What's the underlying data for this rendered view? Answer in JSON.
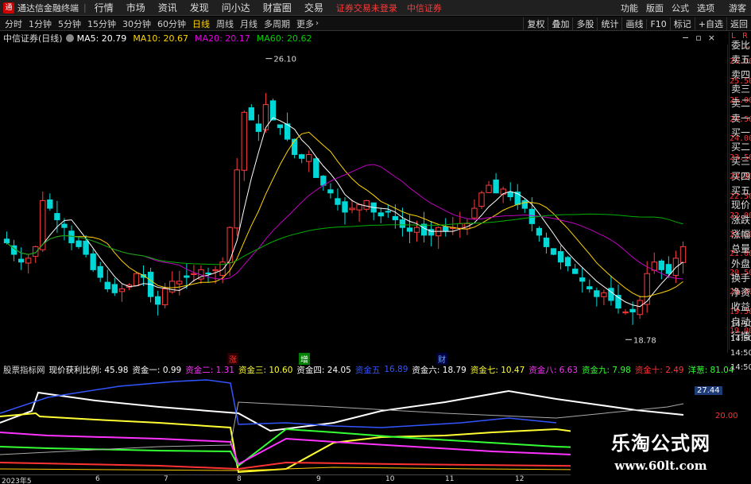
{
  "menubar": {
    "app_title": "通达信金融终端",
    "items": [
      "行情",
      "市场",
      "资讯",
      "发现",
      "问小达",
      "财富圈",
      "交易"
    ],
    "alerts": [
      "证券交易未登录",
      "中信证券"
    ],
    "right_items": [
      "功能",
      "版面",
      "公式",
      "选项",
      "游客"
    ]
  },
  "toolbar": {
    "periods": [
      "分时",
      "1分钟",
      "5分钟",
      "15分钟",
      "30分钟",
      "60分钟",
      "日线",
      "周线",
      "月线",
      "多周期",
      "更多"
    ],
    "active_period": "日线",
    "tools": [
      "复权",
      "叠加",
      "多股",
      "统计",
      "画线",
      "F10",
      "标记",
      "+自选",
      "返回"
    ]
  },
  "info": {
    "name": "中信证券(日线)",
    "ma": [
      {
        "label": "MA5: 20.79",
        "color": "#ffffff"
      },
      {
        "label": "MA10: 20.67",
        "color": "#ffd400"
      },
      {
        "label": "MA20: 20.17",
        "color": "#e000e0"
      },
      {
        "label": "MA60: 20.62",
        "color": "#00d000"
      }
    ]
  },
  "quote_panel": [
    "委比",
    "卖五",
    "卖四",
    "卖三",
    "卖二",
    "卖一",
    "买一",
    "买二",
    "买三",
    "买四",
    "买五",
    "现价",
    "涨跌",
    "涨幅",
    "总量",
    "外盘",
    "换手",
    "净资",
    "收益",
    "自动",
    "行情"
  ],
  "quote_panel_times": [
    "14:50",
    "14:50",
    "14:50",
    "14:50"
  ],
  "quote_panel_header": [
    "L",
    "R",
    "L"
  ],
  "axis": {
    "ticks": [
      "26.00",
      "25.50",
      "25.00",
      "24.50",
      "24.00",
      "23.50",
      "23.00",
      "22.50",
      "22.00",
      "21.50",
      "21.00",
      "20.50",
      "20.00",
      "19.50",
      "19.00"
    ],
    "high_label": "26.10",
    "low_label": "18.78"
  },
  "markers": [
    {
      "text": "涨",
      "color": "#ff3333",
      "bg": "#2a0000"
    },
    {
      "text": "增",
      "color": "#ffffff",
      "bg": "#008000"
    },
    {
      "text": "财",
      "color": "#6fa8ff",
      "bg": "#000040"
    }
  ],
  "indicator": {
    "name": "股票指标网",
    "items": [
      {
        "text": "现价获利比例: 45.98",
        "color": "#ffffff"
      },
      {
        "text": "资金一: 0.99",
        "color": "#ffffff"
      },
      {
        "text": "资金二: 1.31",
        "color": "#ff33ff"
      },
      {
        "text": "资金三: 10.60",
        "color": "#ffff33"
      },
      {
        "text": "资金四: 24.05",
        "color": "#ffffff"
      },
      {
        "text": "资金五",
        "color": "#3355ff"
      },
      {
        "text": "16.89",
        "color": "#3355ff"
      },
      {
        "text": "资金六: 18.79",
        "color": "#ffffff"
      },
      {
        "text": "资金七: 10.47",
        "color": "#ffff33"
      },
      {
        "text": "资金八: 6.63",
        "color": "#ff33ff"
      },
      {
        "text": "资金九: 7.98",
        "color": "#33ff33"
      },
      {
        "text": "资金十: 2.49",
        "color": "#ff3333"
      },
      {
        "text": "洋葱: 81.04",
        "color": "#33ff33"
      }
    ],
    "axis_label": "27.44",
    "axis_label_2": "20.00"
  },
  "dates": [
    "2023年5",
    "6",
    "7",
    "8",
    "9",
    "10",
    "11",
    "12"
  ],
  "watermark": {
    "title": "乐淘公式网",
    "url": "www.60lt.com"
  },
  "chart_data": {
    "type": "candlestick",
    "title": "中信证券(日线)",
    "ylim": [
      18.6,
      26.3
    ],
    "close": [
      21.3,
      21.0,
      20.8,
      20.9,
      21.2,
      22.4,
      22.2,
      21.9,
      21.7,
      21.3,
      21.2,
      21.0,
      20.6,
      20.4,
      20.1,
      20.0,
      20.1,
      20.2,
      20.5,
      20.4,
      19.9,
      19.7,
      20.1,
      20.3,
      20.3,
      20.4,
      20.5,
      20.6,
      20.5,
      20.6,
      20.8,
      21.7,
      23.2,
      24.7,
      24.5,
      24.2,
      24.9,
      24.5,
      24.3,
      24.0,
      23.6,
      23.5,
      23.6,
      23.0,
      22.8,
      22.6,
      22.3,
      22.1,
      22.2,
      22.3,
      22.4,
      22.1,
      22.0,
      22.1,
      21.9,
      21.7,
      21.6,
      21.7,
      21.5,
      21.5,
      21.7,
      21.6,
      21.7,
      21.8,
      21.8,
      22.2,
      22.6,
      22.8,
      22.6,
      22.7,
      22.5,
      22.3,
      22.2,
      21.8,
      21.5,
      21.2,
      21.0,
      20.8,
      20.7,
      20.5,
      20.3,
      20.1,
      19.9,
      20.0,
      19.8,
      19.6,
      19.5,
      19.5,
      19.8,
      20.5,
      20.8,
      20.6,
      20.5,
      20.9,
      21.2
    ]
  }
}
